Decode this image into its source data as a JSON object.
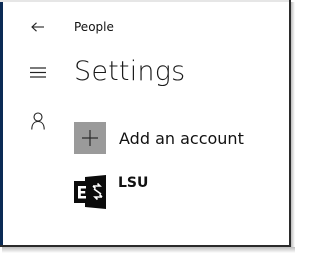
{
  "app": {
    "title": "People"
  },
  "page": {
    "title": "Settings"
  },
  "nav": {
    "back_icon": "back-arrow-icon",
    "menu_icon": "hamburger-menu-icon",
    "account_icon": "person-icon"
  },
  "actions": {
    "add_account_label": "Add an account",
    "add_icon": "plus-icon"
  },
  "accounts": [
    {
      "name": "LSU",
      "icon": "exchange-icon"
    }
  ],
  "colors": {
    "tile_gray": "#9a9a9a",
    "frame_accent": "#0a2a55",
    "text": "#111111"
  }
}
